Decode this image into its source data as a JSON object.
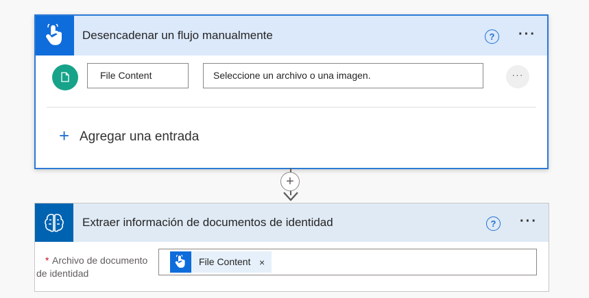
{
  "trigger": {
    "title": "Desencadenar un flujo manualmente",
    "help_icon": "?",
    "more_icon": "···",
    "input": {
      "name": "File Content",
      "placeholder": "Seleccione un archivo o una imagen.",
      "more_icon": "···"
    },
    "add_input": {
      "icon": "+",
      "label": "Agregar una entrada"
    }
  },
  "connector": {
    "plus_icon": "+"
  },
  "action": {
    "title": "Extraer información de documentos de identidad",
    "help_icon": "?",
    "more_icon": "···",
    "field": {
      "required_mark": "*",
      "label_line1": "Archivo de documento",
      "label_line2": "de identidad",
      "token_label": "File Content",
      "token_remove": "×"
    }
  },
  "colors": {
    "trigger_accent": "#0f6cdb",
    "action_accent": "#0063b1",
    "file_badge": "#16a38a",
    "link_blue": "#1f6fd2",
    "required": "#c50f1f"
  }
}
